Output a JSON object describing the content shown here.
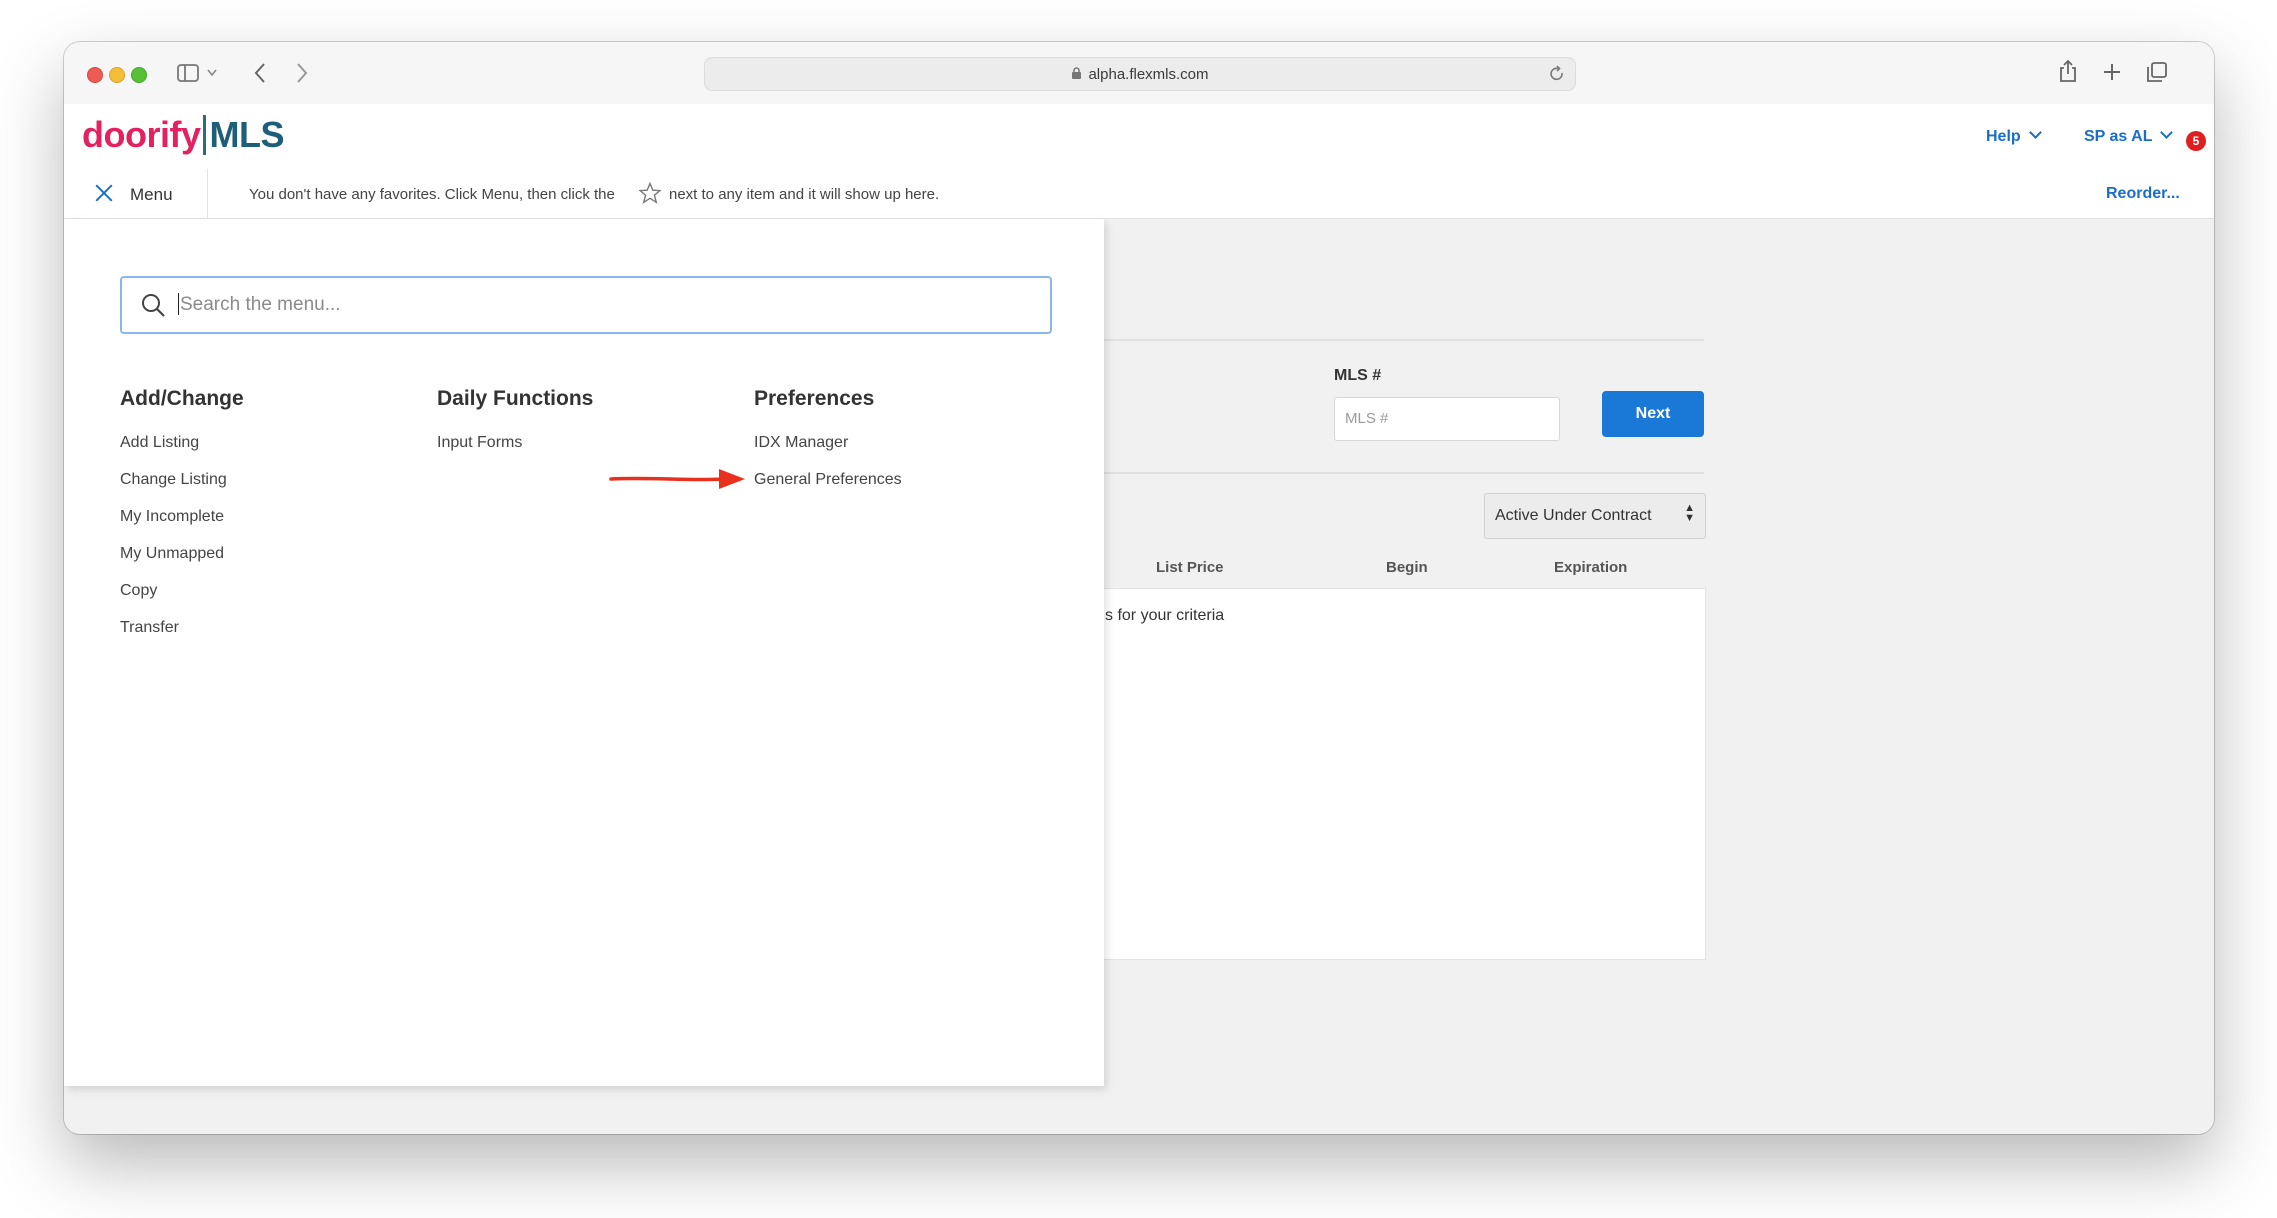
{
  "browser": {
    "url": "alpha.flexmls.com"
  },
  "header": {
    "logo_brand": "doorify",
    "logo_mls": "MLS",
    "help_label": "Help",
    "user_label": "SP as AL",
    "notification_count": "5"
  },
  "favorites": {
    "menu_label": "Menu",
    "text_before": "You don't have any favorites. Click Menu, then click the",
    "text_after": "next to any item and it will show up here.",
    "reorder_label": "Reorder..."
  },
  "search": {
    "placeholder": "Search the menu..."
  },
  "menu": {
    "columns": [
      {
        "title": "Add/Change",
        "items": [
          "Add Listing",
          "Change Listing",
          "My Incomplete",
          "My Unmapped",
          "Copy",
          "Transfer"
        ]
      },
      {
        "title": "Daily Functions",
        "items": [
          "Input Forms"
        ]
      },
      {
        "title": "Preferences",
        "items": [
          "IDX Manager",
          "General Preferences"
        ]
      }
    ]
  },
  "background_page": {
    "mls_label": "MLS #",
    "mls_placeholder": "MLS #",
    "next_label": "Next",
    "status_selected": "Active Under Contract",
    "columns": [
      "List Price",
      "Begin",
      "Expiration"
    ],
    "results_message": "s for your criteria"
  },
  "annotation": {
    "arrow_color": "#e8301e"
  }
}
